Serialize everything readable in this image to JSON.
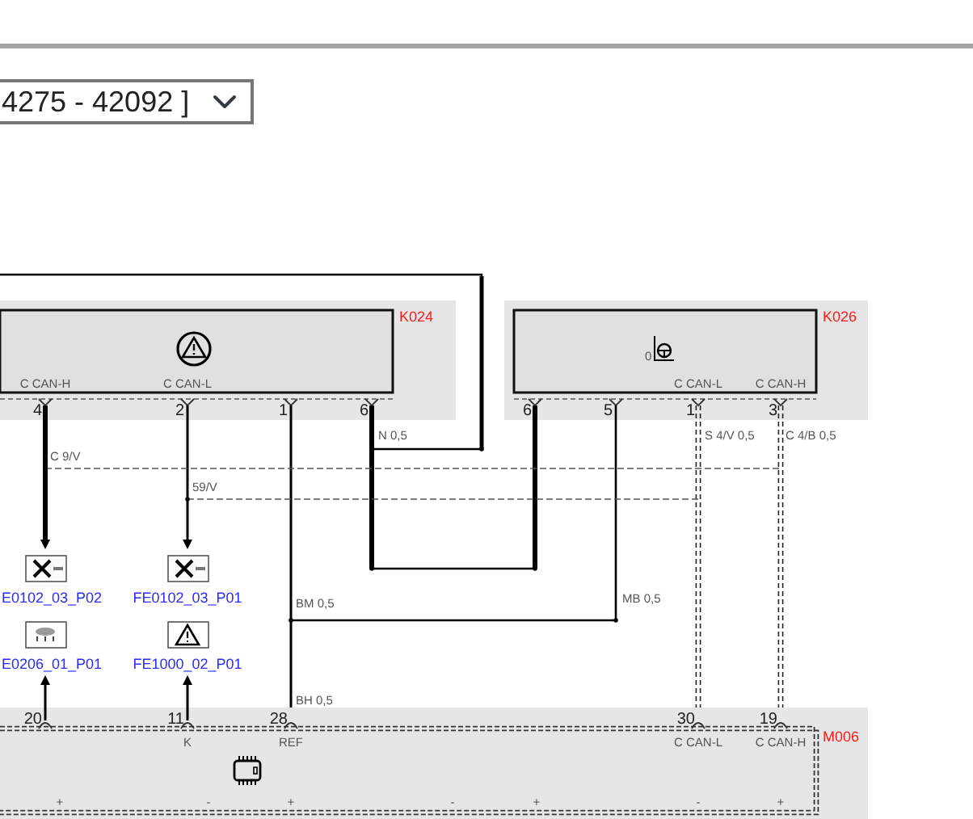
{
  "selector": {
    "value": "4275 - 42092 ]"
  },
  "modules": [
    {
      "label": "K024",
      "kind": "warning",
      "pins": [
        {
          "number": "4",
          "signal": "C CAN-H"
        },
        {
          "number": "2",
          "signal": "C CAN-L"
        },
        {
          "number": "1"
        },
        {
          "number": "6"
        }
      ]
    },
    {
      "label": "K026",
      "kind": "steering",
      "icon_caption": "0",
      "pins": [
        {
          "number": "6"
        },
        {
          "number": "5"
        },
        {
          "number": "1",
          "signal": "C CAN-L"
        },
        {
          "number": "3",
          "signal": "C CAN-H"
        }
      ]
    },
    {
      "label": "M006",
      "kind": "chip",
      "pins": [
        {
          "number": "20"
        },
        {
          "number": "11",
          "signal": "K"
        },
        {
          "number": "28",
          "signal": "REF"
        },
        {
          "number": "30",
          "signal": "C CAN-L"
        },
        {
          "number": "19",
          "signal": "C CAN-H"
        }
      ],
      "polarity_marks": [
        "+",
        "-",
        "+",
        "-",
        "+",
        "-",
        "+"
      ]
    }
  ],
  "wire_labels": [
    "C 9/V",
    "59/V",
    "N 0,5",
    "S 4/V 0,5",
    "C 4/B 0,5",
    "BM 0,5",
    "MB 0,5",
    "BH 0,5"
  ],
  "links": [
    {
      "text": "E0102_03_P02",
      "kind": "connector"
    },
    {
      "text": "FE0102_03_P01",
      "kind": "connector"
    },
    {
      "text": "E0206_01_P01",
      "kind": "lamp"
    },
    {
      "text": "FE1000_02_P01",
      "kind": "warning"
    }
  ]
}
